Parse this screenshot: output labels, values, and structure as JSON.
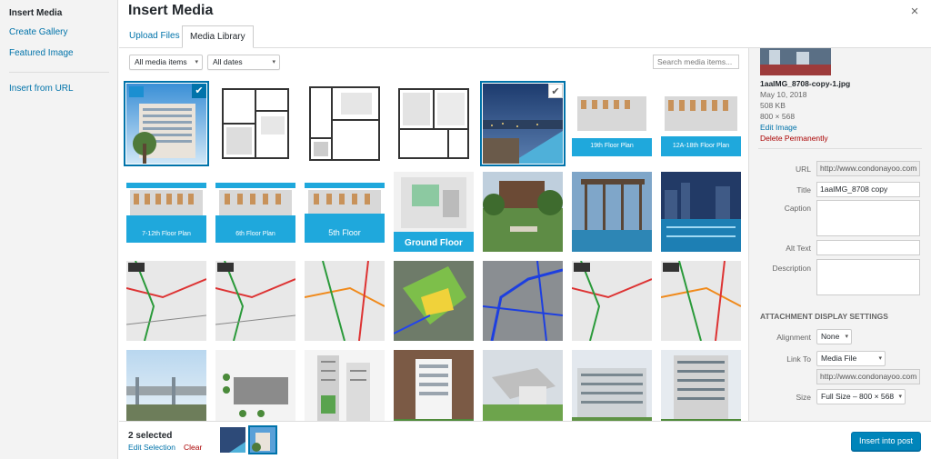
{
  "menu": {
    "items": [
      "Insert Media",
      "Create Gallery",
      "Featured Image",
      "Insert from URL"
    ]
  },
  "modal": {
    "title": "Insert Media",
    "close_icon": "×"
  },
  "tabs": [
    "Upload Files",
    "Media Library"
  ],
  "toolbar": {
    "filter_type": "All media items",
    "filter_date": "All dates",
    "search_placeholder": "Search media items..."
  },
  "grid": {
    "captions": {
      "5": "19th Floor Plan",
      "6": "12A-18th Floor Plan",
      "7": "7-12th Floor Plan",
      "8": "6th Floor Plan",
      "9": "5th Floor",
      "10": "Ground Floor"
    },
    "selected_indices": [
      0,
      4
    ]
  },
  "details": {
    "filename": "1aaIMG_8708-copy-1.jpg",
    "date": "May 10, 2018",
    "filesize": "508 KB",
    "dimensions": "800 × 568",
    "edit_link": "Edit Image",
    "delete_link": "Delete Permanently",
    "fields": {
      "url_label": "URL",
      "url_value": "http://www.condonayoo.com",
      "title_label": "Title",
      "title_value": "1aaIMG_8708 copy",
      "caption_label": "Caption",
      "alt_label": "Alt Text",
      "description_label": "Description"
    },
    "display_settings": {
      "heading": "ATTACHMENT DISPLAY SETTINGS",
      "alignment_label": "Alignment",
      "alignment_value": "None",
      "link_label": "Link To",
      "link_value": "Media File",
      "link_url": "http://www.condonayoo.com",
      "size_label": "Size",
      "size_value": "Full Size – 800 × 568"
    }
  },
  "footer": {
    "selected_count": "2 selected",
    "edit_selection": "Edit Selection",
    "clear": "Clear",
    "insert_button": "Insert into post"
  },
  "colors": {
    "accent": "#0073aa",
    "button": "#0085ba",
    "danger": "#a00000",
    "sidebar_bg": "#f3f3f3"
  }
}
